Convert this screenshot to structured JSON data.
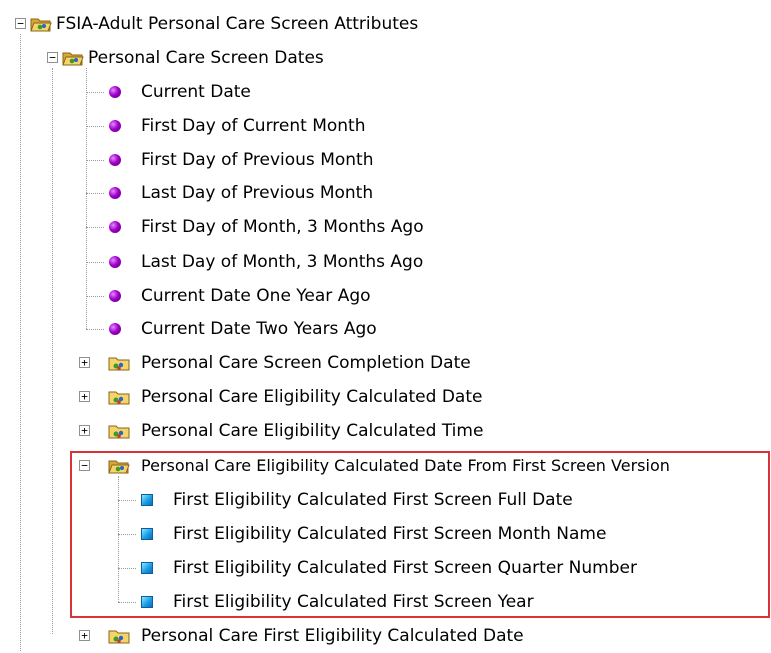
{
  "tree": {
    "root": {
      "label": "FSIA-Adult Personal Care Screen Attributes",
      "expander": "−"
    },
    "dates_folder": {
      "label": "Personal Care Screen Dates",
      "expander": "−"
    },
    "date_items": [
      "Current Date",
      "First Day of Current Month",
      "First Day of Previous Month",
      "Last Day of Previous Month",
      "First Day of Month, 3 Months Ago",
      "Last Day of Month, 3 Months Ago",
      "Current Date One Year Ago",
      "Current Date Two Years Ago"
    ],
    "collapsed_folders": [
      "Personal Care Screen Completion Date",
      "Personal Care Eligibility Calculated Date",
      "Personal Care Eligibility Calculated Time"
    ],
    "expanded_folder": {
      "label": "Personal Care Eligibility Calculated Date From First Screen Version",
      "expander": "−"
    },
    "attribute_items": [
      "First Eligibility Calculated First Screen Full Date",
      "First Eligibility Calculated First Screen Month Name",
      "First Eligibility Calculated First Screen Quarter Number",
      "First Eligibility Calculated First Screen Year"
    ],
    "last_folder": {
      "label": "Personal Care First Eligibility Calculated Date",
      "expander": "+"
    },
    "collapsed_expander": "+"
  },
  "colors": {
    "highlight_border": "#d9333a",
    "attribute_bullet": "#a000c8",
    "attribute_square": "#1a9ee6"
  },
  "icons": {
    "folder_open": "folder-open-icon",
    "folder_closed": "folder-closed-icon",
    "attribute": "attribute-bullet-icon",
    "column": "column-square-icon"
  }
}
